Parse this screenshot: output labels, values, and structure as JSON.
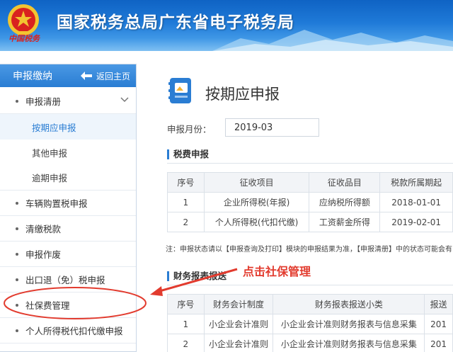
{
  "header": {
    "site_title": "国家税务总局广东省电子税务局",
    "emblem_text": "中国税务"
  },
  "sidebar": {
    "title": "申报缴纳",
    "back_home": "返回主页",
    "items": [
      {
        "label": "申报清册",
        "expanded": true,
        "children": [
          "按期应申报",
          "其他申报",
          "逾期申报"
        ]
      },
      {
        "label": "车辆购置税申报"
      },
      {
        "label": "清缴税款"
      },
      {
        "label": "申报作废"
      },
      {
        "label": "出口退（免）税申报"
      },
      {
        "label": "社保费管理"
      },
      {
        "label": "个人所得税代扣代缴申报"
      }
    ],
    "active_child": "按期应申报"
  },
  "main": {
    "title": "按期应申报",
    "period_label": "申报月份：",
    "period_value": "2019-03",
    "tax_section": {
      "title": "税费申报",
      "columns": [
        "序号",
        "征收项目",
        "征收品目",
        "税款所属期起"
      ],
      "rows": [
        [
          "1",
          "企业所得税(年报)",
          "应纳税所得额",
          "2018-01-01"
        ],
        [
          "2",
          "个人所得税(代扣代缴)",
          "工资薪金所得",
          "2019-02-01"
        ]
      ]
    },
    "note": "注：申报状态请以【申报查询及打印】模块的申报结果为准，【申报清册】中的状态可能会有",
    "finance_section": {
      "title": "财务报表报送",
      "columns": [
        "序号",
        "财务会计制度",
        "财务报表报送小类",
        "报送"
      ],
      "rows": [
        [
          "1",
          "小企业会计准则",
          "小企业会计准则财务报表与信息采集",
          "201"
        ],
        [
          "2",
          "小企业会计准则",
          "小企业会计准则财务报表与信息采集",
          "201"
        ]
      ]
    }
  },
  "annotation": {
    "text": "点击社保管理",
    "color": "#e23b2e"
  },
  "colors": {
    "accent": "#2a7dd3",
    "header_top": "#0f63c4",
    "annotation": "#e23b2e"
  }
}
